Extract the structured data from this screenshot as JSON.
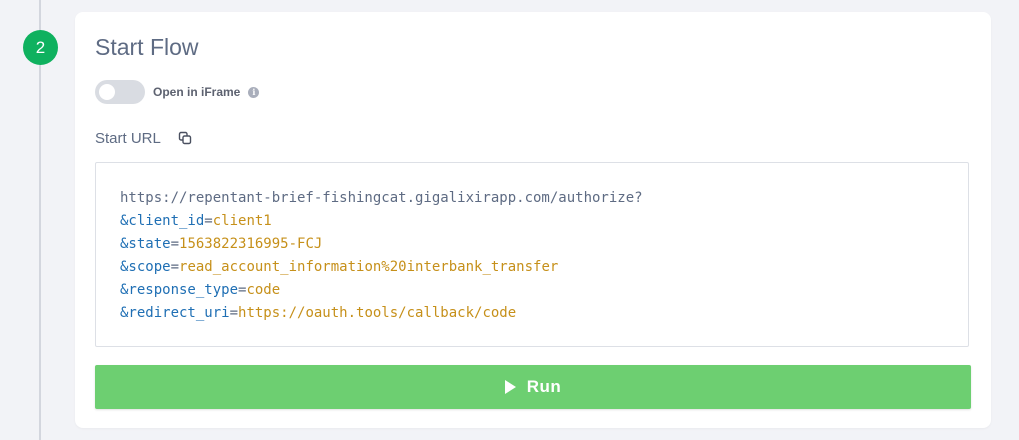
{
  "step": {
    "number": "2",
    "color": "#0fb15f"
  },
  "card": {
    "title": "Start Flow"
  },
  "iframe_toggle": {
    "label": "Open in iFrame",
    "state": "off",
    "info_icon": "info-icon"
  },
  "start_url": {
    "label": "Start URL",
    "copy_icon": "copy-icon",
    "base": "https://repentant-brief-fishingcat.gigalixirapp.com/authorize?",
    "params": [
      {
        "key": "&client_id",
        "eq": "=",
        "value": "client1"
      },
      {
        "key": "&state",
        "eq": "=",
        "value": "1563822316995-FCJ"
      },
      {
        "key": "&scope",
        "eq": "=",
        "value": "read_account_information%20interbank_transfer"
      },
      {
        "key": "&response_type",
        "eq": "=",
        "value": "code"
      },
      {
        "key": "&redirect_uri",
        "eq": "=",
        "value": "https://oauth.tools/callback/code"
      }
    ]
  },
  "run_button": {
    "label": "Run",
    "icon": "play-icon",
    "color": "#6dcf71"
  }
}
